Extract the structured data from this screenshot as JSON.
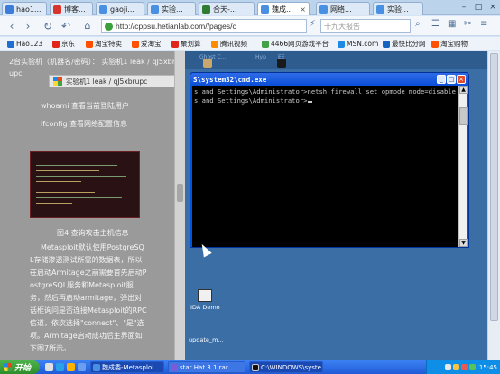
{
  "browser": {
    "tabs": [
      {
        "label": "hao1...",
        "color": "#3b7dd8",
        "active": false
      },
      {
        "label": "博客...",
        "color": "#d9342b",
        "active": false
      },
      {
        "label": "gaoji...",
        "color": "#4a90e2",
        "active": false
      },
      {
        "label": "实验...",
        "color": "#4a90e2",
        "active": false
      },
      {
        "label": "合天-...",
        "color": "#2e7d32",
        "active": false
      },
      {
        "label": "魏成...",
        "color": "#4a90e2",
        "active": true
      },
      {
        "label": "网络...",
        "color": "#4a90e2",
        "active": false
      },
      {
        "label": "实验...",
        "color": "#4a90e2",
        "active": false
      }
    ],
    "address": "http://cppsu.hetianlab.com//pages/c",
    "search_placeholder": "十九大报告",
    "bookmarks": [
      {
        "label": "Hao123",
        "color": "#1f6fd1"
      },
      {
        "label": "京东",
        "color": "#e1251b"
      },
      {
        "label": "淘宝特卖",
        "color": "#ff5000"
      },
      {
        "label": "爱淘宝",
        "color": "#ff5000"
      },
      {
        "label": "聚划算",
        "color": "#e1251b"
      },
      {
        "label": "腾讯视频",
        "color": "#ff8c00"
      },
      {
        "label": "4466网页游戏平台",
        "color": "#43a047"
      },
      {
        "label": "MSN.com",
        "color": "#1e88e5"
      },
      {
        "label": "最快比分网",
        "color": "#1565c0"
      },
      {
        "label": "淘宝购物",
        "color": "#ff5000"
      }
    ]
  },
  "article": {
    "header_line1": "2台实验机（机器名/密码）： 实验机1  leak / qJ5xbr",
    "header_line2": "upc",
    "rdp_bar_text": "实验机1   leak / qJ5xbrupc",
    "para1": "whoami 查看当前登陆用户",
    "para2": "ifconfig 查看网络配置信息",
    "caption": "图4 查询攻击主机信息",
    "body_lines": [
      "Metasploit默认使用PostgreSQ",
      "L存储渗透测试所需的数据表，所以",
      "在启动Armitage之前需要首先启动P",
      "ostgreSQL服务和Metasploit服",
      "务，然后再启动armitage，弹出对",
      "话框询问是否连接Metasploit的RPC",
      "信道，依次选择\"connect\"、\"是\"选",
      "项。Armitage启动成功后主界面如",
      "下图7所示。"
    ]
  },
  "remote": {
    "top_labels": [
      "Ghost C…",
      "Hyp",
      "EE"
    ],
    "desktop_icons": [
      {
        "label": "IDA Demo"
      },
      {
        "label": "update_m..."
      }
    ]
  },
  "cmd": {
    "title": "S\\system32\\cmd.exe",
    "lines": [
      "s and Settings\\Administrator>netsh firewall set opmode mode=disable",
      "",
      "",
      "s and Settings\\Administrator>"
    ]
  },
  "taskbar": {
    "start_label": "开始",
    "items": [
      {
        "label": "魏成委-Metasploi...",
        "color": "#4a90e2"
      },
      {
        "label": "star Hat 3.1 rar...",
        "color": "#7b5cd6"
      },
      {
        "label": "C:\\WINDOWS\\syste...",
        "color": "#111111"
      }
    ],
    "clock": "15:45"
  }
}
